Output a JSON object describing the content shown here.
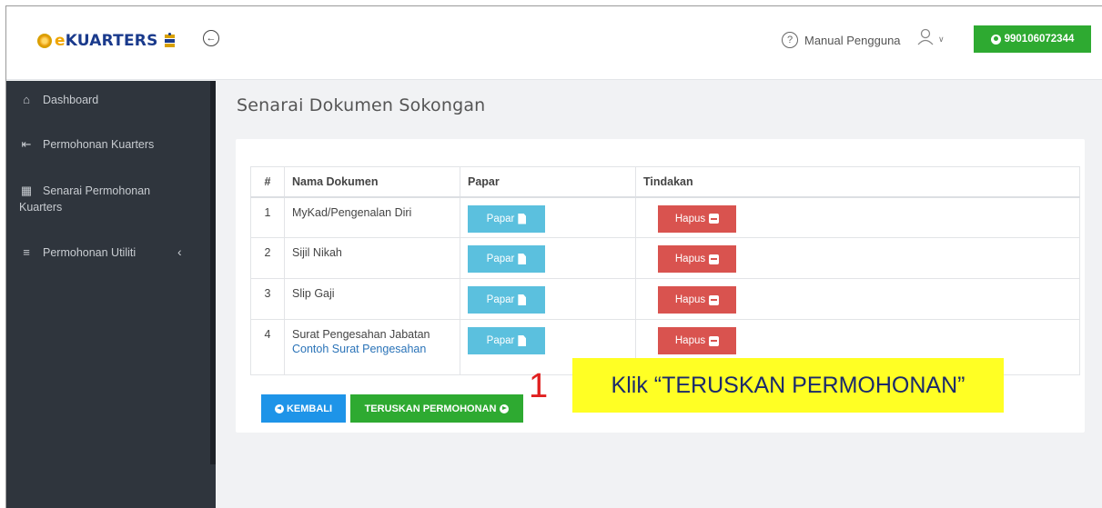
{
  "header": {
    "logo_prefix": "e",
    "logo_text": "KUARTERS",
    "manual_label": "Manual Pengguna",
    "user_id": "990106072344"
  },
  "sidebar": {
    "items": [
      {
        "label": "Dashboard",
        "icon": "home-icon"
      },
      {
        "label": "Permohonan Kuarters",
        "icon": "sign-in-icon"
      },
      {
        "label_line1": "Senarai Permohonan",
        "label_line2": "Kuarters",
        "icon": "building-icon"
      },
      {
        "label": "Permohonan Utiliti",
        "icon": "layers-icon"
      }
    ]
  },
  "main": {
    "title": "Senarai Dokumen Sokongan",
    "table": {
      "headers": [
        "#",
        "Nama Dokumen",
        "Papar",
        "Tindakan"
      ],
      "rows": [
        {
          "num": "1",
          "name": "MyKad/Pengenalan Diri",
          "view_label": "Papar",
          "action_label": "Hapus"
        },
        {
          "num": "2",
          "name": "Sijil Nikah",
          "view_label": "Papar",
          "action_label": "Hapus"
        },
        {
          "num": "3",
          "name": "Slip Gaji",
          "view_label": "Papar",
          "action_label": "Hapus"
        },
        {
          "num": "4",
          "name": "Surat Pengesahan Jabatan",
          "link": "Contoh Surat Pengesahan",
          "view_label": "Papar",
          "action_label": "Hapus"
        }
      ]
    },
    "back_label": "KEMBALI",
    "next_label": "TERUSKAN PERMOHONAN"
  },
  "annotation": {
    "step": "1",
    "callout": "Klik “TERUSKAN PERMOHONAN”"
  },
  "colors": {
    "sidebar_bg": "#2f353d",
    "green": "#2eaa31",
    "info": "#5bc0de",
    "danger": "#d9534f",
    "primary": "#1e94e8",
    "callout_bg": "#ffff24"
  }
}
